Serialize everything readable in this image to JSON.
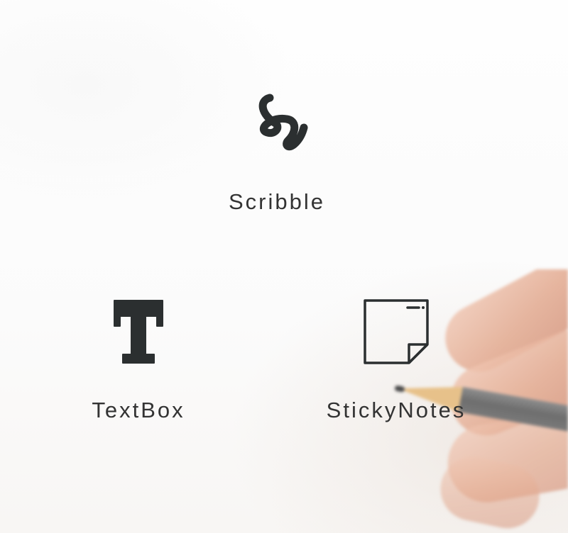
{
  "colors": {
    "icon": "#2b2f30",
    "label": "#333333",
    "background": "#fdfdfd"
  },
  "tools": {
    "scribble": {
      "label": "Scribble",
      "icon": "scribble-icon"
    },
    "textbox": {
      "label": "TextBox",
      "icon": "text-t-icon"
    },
    "sticky_notes": {
      "label": "StickyNotes",
      "icon": "sticky-note-icon"
    }
  }
}
